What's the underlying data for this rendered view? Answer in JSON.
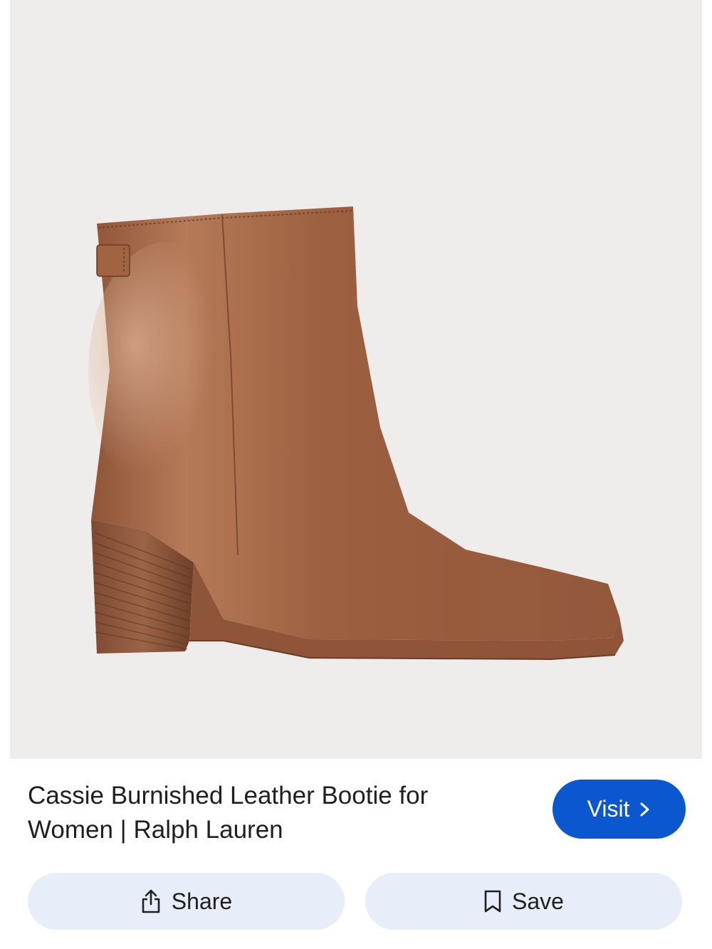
{
  "product": {
    "title_line1": "Cassie Burnished Leather Bootie for",
    "title_line2": "Women | Ralph Lauren",
    "image": "brown-leather-ankle-boot-photo"
  },
  "actions": {
    "visit_label": "Visit",
    "share_label": "Share",
    "save_label": "Save"
  },
  "icons": {
    "visit": "chevron-right-icon",
    "share": "share-icon",
    "save": "bookmark-icon"
  },
  "colors": {
    "accent": "#0b57d0",
    "button_bg": "#e8eef9",
    "image_bg": "#efedec"
  }
}
